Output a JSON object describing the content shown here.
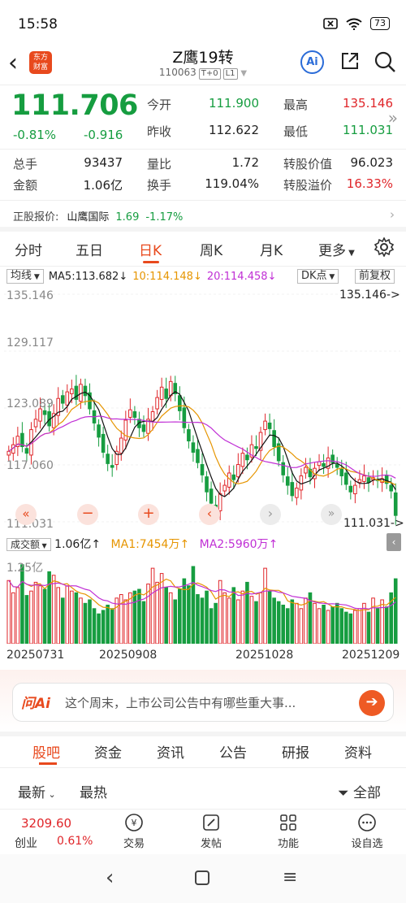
{
  "status": {
    "time": "15:58",
    "battery": "73"
  },
  "header": {
    "title": "Z鹰19转",
    "code": "110063",
    "tag1": "T+0",
    "tag2": "L1",
    "logo_line1": "东方",
    "logo_line2": "财富",
    "ai_label": "Ai"
  },
  "quote": {
    "price": "111.706",
    "change_pct": "-0.81%",
    "change_val": "-0.916",
    "total_hands_label": "总手",
    "total_hands": "93437",
    "amount_label": "金额",
    "amount": "1.06亿",
    "open_label": "今开",
    "open": "111.900",
    "prev_close_label": "昨收",
    "prev_close": "112.622",
    "vol_ratio_label": "量比",
    "vol_ratio": "1.72",
    "turnover_label": "换手",
    "turnover": "119.04%",
    "high_label": "最高",
    "high": "135.146",
    "low_label": "最低",
    "low": "111.031",
    "conv_value_label": "转股价值",
    "conv_value": "96.023",
    "conv_premium_label": "转股溢价",
    "conv_premium": "16.33%"
  },
  "underlying": {
    "label": "正股报价:",
    "name": "山鹰国际",
    "price": "1.69",
    "change": "-1.17%"
  },
  "tabs": [
    "分时",
    "五日",
    "日K",
    "周K",
    "月K",
    "更多"
  ],
  "ma": {
    "label": "均线",
    "ma5": "MA5:113.682",
    "ma10": "10:114.148",
    "ma20": "20:114.458",
    "dk": "DK点",
    "adj": "前复权"
  },
  "kline": {
    "y_top": "135.146",
    "y_2": "129.117",
    "y_3": "123.089",
    "y_4": "117.060",
    "y_bottom": "111.031",
    "max_mark": "135.146->",
    "min_mark": "111.031->"
  },
  "volume": {
    "label": "成交额",
    "value": "1.06亿",
    "ma1": "MA1:7454万",
    "ma2": "MA2:5960万",
    "y_top": "1.25亿",
    "dates": [
      "20250731",
      "20250908",
      "20251028",
      "20251209"
    ]
  },
  "ask": {
    "logo": "问Ai",
    "text": "这个周末，上市公司公告中有哪些重大事..."
  },
  "content_tabs": [
    "股吧",
    "资金",
    "资讯",
    "公告",
    "研报",
    "资料"
  ],
  "sort": {
    "latest": "最新",
    "hottest": "最热",
    "filter": "全部"
  },
  "bottom_nav": {
    "index_value": "3209.60",
    "index_name": "创业",
    "index_change": "0.61%",
    "items": [
      "交易",
      "发帖",
      "功能",
      "设自选"
    ]
  },
  "colors": {
    "up": "#e0262a",
    "down": "#169d40",
    "accent": "#e8491d",
    "ma5": "#111111",
    "ma10": "#e69500",
    "ma20": "#c02fd5"
  },
  "chart_data": {
    "type": "candlestick",
    "ylim": [
      111.031,
      135.146
    ],
    "x_labels": [
      "20250731",
      "20250908",
      "20251028",
      "20251209"
    ],
    "close_series": [
      118.5,
      119.2,
      120.1,
      119.0,
      118.3,
      120.8,
      121.9,
      123.0,
      122.4,
      121.2,
      122.5,
      124.1,
      123.6,
      124.8,
      125.1,
      124.0,
      125.6,
      124.4,
      123.0,
      121.5,
      120.0,
      118.4,
      117.2,
      116.8,
      118.5,
      119.9,
      121.8,
      122.9,
      122.1,
      121.0,
      120.6,
      121.9,
      122.7,
      124.2,
      125.3,
      124.1,
      125.9,
      124.6,
      122.8,
      121.0,
      119.6,
      118.4,
      117.3,
      116.0,
      114.2,
      113.0,
      112.4,
      114.0,
      114.9,
      116.2,
      115.5,
      117.1,
      118.3,
      117.6,
      119.2,
      118.8,
      120.5,
      121.7,
      120.9,
      119.0,
      117.5,
      116.0,
      114.9,
      113.8,
      114.6,
      115.9,
      116.8,
      115.8,
      116.7,
      117.4,
      116.9,
      117.8,
      117.3,
      116.8,
      115.9,
      115.0,
      114.2,
      114.9,
      115.5,
      115.9,
      115.2,
      115.7,
      115.4,
      115.6,
      115.1,
      114.3,
      111.706
    ],
    "volume_series": [
      72,
      58,
      64,
      90,
      55,
      60,
      70,
      66,
      62,
      82,
      78,
      64,
      52,
      66,
      60,
      58,
      52,
      46,
      50,
      40,
      34,
      38,
      44,
      40,
      52,
      56,
      50,
      58,
      60,
      62,
      48,
      68,
      86,
      70,
      80,
      64,
      58,
      50,
      62,
      74,
      66,
      88,
      56,
      52,
      60,
      40,
      46,
      72,
      58,
      52,
      64,
      50,
      60,
      70,
      54,
      48,
      58,
      86,
      60,
      52,
      48,
      44,
      40,
      50,
      46,
      40,
      52,
      58,
      46,
      40,
      44,
      38,
      42,
      46,
      40,
      36,
      34,
      38,
      40,
      46,
      36,
      52,
      40,
      50,
      42,
      58,
      74
    ]
  }
}
